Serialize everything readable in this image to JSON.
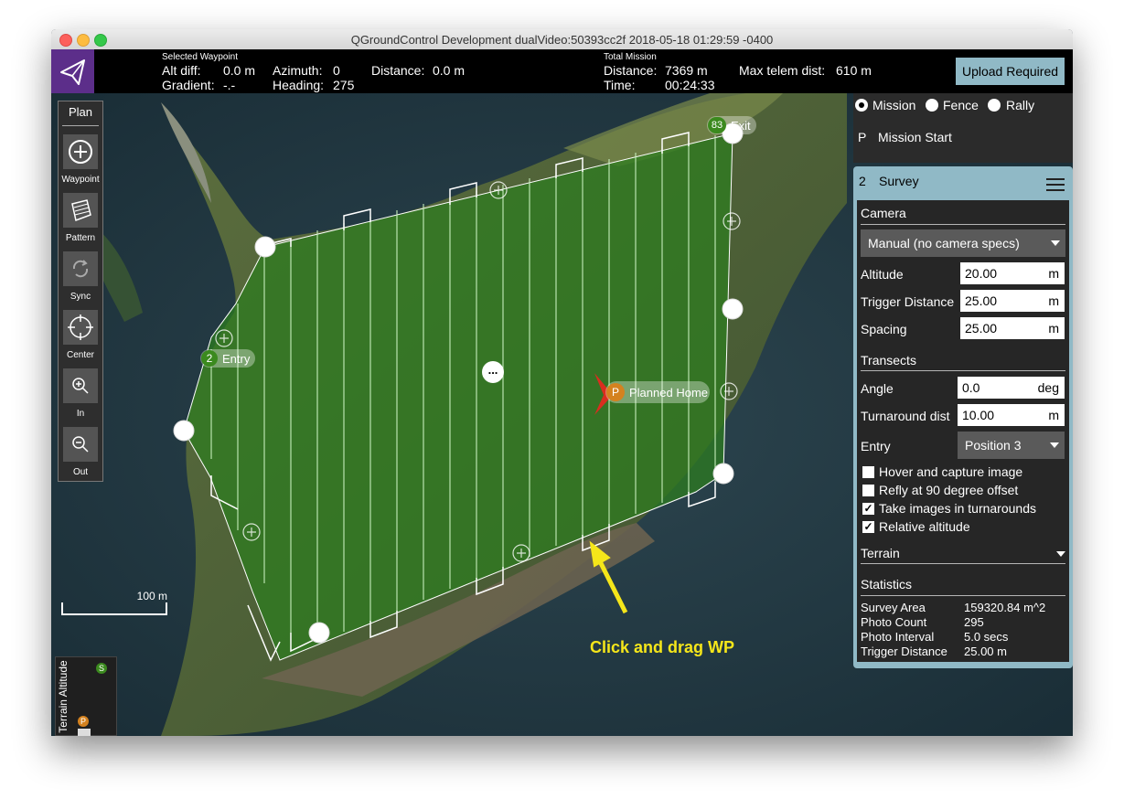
{
  "window": {
    "title": "QGroundControl Development dualVideo:50393cc2f 2018-05-18 01:29:59 -0400"
  },
  "toolbar": {
    "selected_waypoint": {
      "heading": "Selected Waypoint",
      "alt_diff_label": "Alt diff:",
      "alt_diff_value": "0.0 m",
      "gradient_label": "Gradient:",
      "gradient_value": "-.-",
      "azimuth_label": "Azimuth:",
      "azimuth_value": "0",
      "heading_label": "Heading:",
      "heading_value": "275",
      "distance_label": "Distance:",
      "distance_value": "0.0 m"
    },
    "total_mission": {
      "heading": "Total Mission",
      "distance_label": "Distance:",
      "distance_value": "7369 m",
      "time_label": "Time:",
      "time_value": "00:24:33",
      "max_telem_label": "Max telem dist:",
      "max_telem_value": "610 m"
    },
    "upload_label": "Upload Required"
  },
  "plan_toolbar": {
    "title": "Plan",
    "tools": [
      {
        "label": "Waypoint",
        "icon": "add-circle-icon"
      },
      {
        "label": "Pattern",
        "icon": "pattern-icon"
      },
      {
        "label": "Sync",
        "icon": "sync-icon"
      },
      {
        "label": "Center",
        "icon": "crosshair-icon"
      },
      {
        "label": "In",
        "icon": "zoom-in-icon"
      },
      {
        "label": "Out",
        "icon": "zoom-out-icon"
      }
    ]
  },
  "map": {
    "scale_label": "100 m",
    "entry_number": "2",
    "entry_label": "Entry",
    "exit_number": "83",
    "exit_label": "Exit",
    "home_letter": "P",
    "home_label": "Planned Home",
    "more_label": "...",
    "annotation": "Click and drag WP",
    "terrain_label": "Terrain Altitude",
    "terrain_s": "S",
    "terrain_p": "P"
  },
  "mode": {
    "options": [
      "Mission",
      "Fence",
      "Rally"
    ],
    "selected": "Mission"
  },
  "mission_start": {
    "letter": "P",
    "label": "Mission Start"
  },
  "survey": {
    "number": "2",
    "title": "Survey",
    "camera_section": "Camera",
    "camera_select": "Manual (no camera specs)",
    "fields": [
      {
        "label": "Altitude",
        "value": "20.00",
        "unit": "m"
      },
      {
        "label": "Trigger Distance",
        "value": "25.00",
        "unit": "m"
      },
      {
        "label": "Spacing",
        "value": "25.00",
        "unit": "m"
      }
    ],
    "transects_section": "Transects",
    "transect_fields": [
      {
        "label": "Angle",
        "value": "0.0",
        "unit": "deg"
      },
      {
        "label": "Turnaround dist",
        "value": "10.00",
        "unit": "m"
      }
    ],
    "entry_label": "Entry",
    "entry_select": "Position 3",
    "checkboxes": [
      {
        "label": "Hover and capture image",
        "checked": false
      },
      {
        "label": "Refly at 90 degree offset",
        "checked": false
      },
      {
        "label": "Take images in turnarounds",
        "checked": true
      },
      {
        "label": "Relative altitude",
        "checked": true
      }
    ],
    "terrain_section": "Terrain",
    "statistics_section": "Statistics",
    "stats": [
      {
        "label": "Survey Area",
        "value": "159320.84 m^2"
      },
      {
        "label": "Photo Count",
        "value": "295"
      },
      {
        "label": "Photo Interval",
        "value": "5.0 secs"
      },
      {
        "label": "Trigger Distance",
        "value": "25.00 m"
      }
    ]
  },
  "colors": {
    "accent": "#90b9c6",
    "logo_bg": "#5c2e8a",
    "survey_fill": "#2c7d1f",
    "annotation": "#f5e61a",
    "home": "#d4821f",
    "marker_green": "#3b8a1e"
  }
}
